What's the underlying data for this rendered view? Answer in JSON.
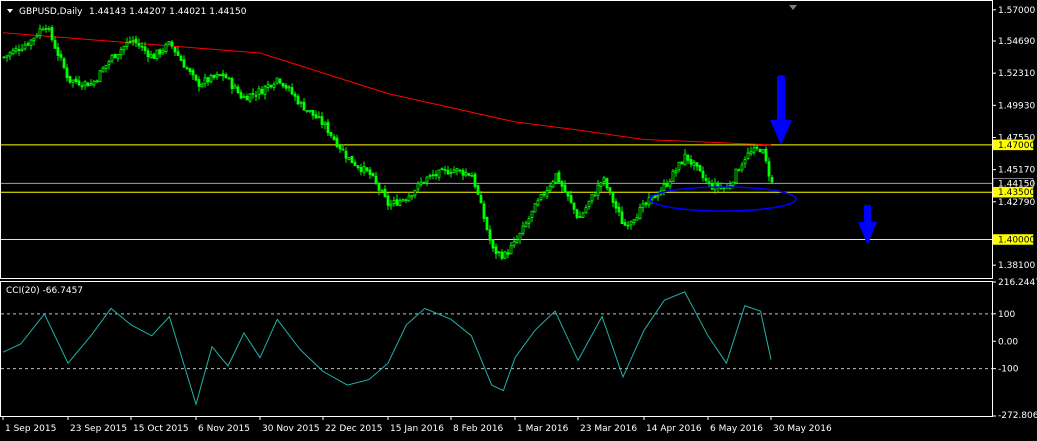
{
  "header": {
    "symbol_label": "GBPUSD,Daily",
    "ohlc_label": "1.44143 1.44207 1.44021 1.44150"
  },
  "colors": {
    "background": "#000000",
    "frame": "#ffffff",
    "bull": "#00ff00",
    "ma": "#ff0000",
    "hline": "#ffff00",
    "bid": "#a0a0a0",
    "cci": "#20b2aa",
    "annot": "#0000ff"
  },
  "chart_data": [
    {
      "type": "candlestick",
      "title": "GBPUSD,Daily",
      "ylim": [
        1.3715,
        1.5765
      ],
      "yticks": [
        "1.57000",
        "1.54690",
        "1.52310",
        "1.49930",
        "1.47550",
        "1.45170",
        "1.42790",
        "1.38100"
      ],
      "price_labels": [
        {
          "text": "1.47000",
          "value": 1.47,
          "style": "yellow"
        },
        {
          "text": "1.44150",
          "value": 1.4415,
          "style": "grey"
        },
        {
          "text": "1.43500",
          "value": 1.435,
          "style": "yellow"
        },
        {
          "text": "1.40000",
          "value": 1.4,
          "style": "yellow"
        }
      ],
      "horizontal_lines": [
        1.47,
        1.435,
        1.4
      ],
      "bid_line": 1.4415,
      "x": [
        "1 Sep 2015",
        "23 Sep 2015",
        "15 Oct 2015",
        "6 Nov 2015",
        "30 Nov 2015",
        "22 Dec 2015",
        "15 Jan 2016",
        "8 Feb 2016",
        "1 Mar 2016",
        "23 Mar 2016",
        "14 Apr 2016",
        "6 May 2016",
        "30 May 2016"
      ],
      "close_path": [
        [
          "1 Sep 2015",
          1.535
        ],
        [
          "10 Sep 2015",
          1.547
        ],
        [
          "15 Sep 2015",
          1.56
        ],
        [
          "23 Sep 2015",
          1.518
        ],
        [
          "1 Oct 2015",
          1.515
        ],
        [
          "8 Oct 2015",
          1.535
        ],
        [
          "15 Oct 2015",
          1.548
        ],
        [
          "22 Oct 2015",
          1.535
        ],
        [
          "28 Oct 2015",
          1.545
        ],
        [
          "6 Nov 2015",
          1.515
        ],
        [
          "16 Nov 2015",
          1.522
        ],
        [
          "23 Nov 2015",
          1.505
        ],
        [
          "30 Nov 2015",
          1.51
        ],
        [
          "6 Dec 2015",
          1.52
        ],
        [
          "14 Dec 2015",
          1.5
        ],
        [
          "22 Dec 2015",
          1.485
        ],
        [
          "31 Dec 2015",
          1.46
        ],
        [
          "8 Jan 2016",
          1.448
        ],
        [
          "15 Jan 2016",
          1.425
        ],
        [
          "22 Jan 2016",
          1.432
        ],
        [
          "29 Jan 2016",
          1.445
        ],
        [
          "8 Feb 2016",
          1.452
        ],
        [
          "15 Feb 2016",
          1.448
        ],
        [
          "22 Feb 2016",
          1.392
        ],
        [
          "26 Feb 2016",
          1.388
        ],
        [
          "1 Mar 2016",
          1.398
        ],
        [
          "8 Mar 2016",
          1.425
        ],
        [
          "15 Mar 2016",
          1.448
        ],
        [
          "23 Mar 2016",
          1.415
        ],
        [
          "31 Mar 2016",
          1.445
        ],
        [
          "7 Apr 2016",
          1.41
        ],
        [
          "14 Apr 2016",
          1.425
        ],
        [
          "21 Apr 2016",
          1.44
        ],
        [
          "28 Apr 2016",
          1.462
        ],
        [
          "6 May 2016",
          1.44
        ],
        [
          "13 May 2016",
          1.438
        ],
        [
          "20 May 2016",
          1.462
        ],
        [
          "26 May 2016",
          1.468
        ],
        [
          "30 May 2016",
          1.4415
        ]
      ],
      "moving_average": [
        [
          "1 Sep 2015",
          1.553
        ],
        [
          "30 Nov 2015",
          1.538
        ],
        [
          "15 Jan 2016",
          1.508
        ],
        [
          "1 Mar 2016",
          1.487
        ],
        [
          "23 Mar 2016",
          1.481
        ],
        [
          "14 Apr 2016",
          1.474
        ],
        [
          "30 May 2016",
          1.47
        ]
      ]
    },
    {
      "type": "line",
      "title": "CCI(20) -66.7457",
      "ylim": [
        -272.8061,
        216.2447
      ],
      "yticks": [
        "216.2447",
        "100",
        "0.00",
        "-100",
        "-272.8061"
      ],
      "levels": [
        100,
        -100
      ],
      "series": [
        {
          "name": "CCI(20)",
          "values": [
            [
              "1 Sep 2015",
              -40
            ],
            [
              "7 Sep 2015",
              -10
            ],
            [
              "15 Sep 2015",
              100
            ],
            [
              "23 Sep 2015",
              -80
            ],
            [
              "1 Oct 2015",
              20
            ],
            [
              "8 Oct 2015",
              120
            ],
            [
              "15 Oct 2015",
              60
            ],
            [
              "22 Oct 2015",
              20
            ],
            [
              "28 Oct 2015",
              90
            ],
            [
              "6 Nov 2015",
              -230
            ],
            [
              "12 Nov 2015",
              -20
            ],
            [
              "18 Nov 2015",
              -90
            ],
            [
              "24 Nov 2015",
              30
            ],
            [
              "30 Nov 2015",
              -60
            ],
            [
              "6 Dec 2015",
              80
            ],
            [
              "14 Dec 2015",
              -30
            ],
            [
              "22 Dec 2015",
              -110
            ],
            [
              "31 Dec 2015",
              -160
            ],
            [
              "8 Jan 2016",
              -140
            ],
            [
              "15 Jan 2016",
              -80
            ],
            [
              "22 Jan 2016",
              60
            ],
            [
              "29 Jan 2016",
              120
            ],
            [
              "8 Feb 2016",
              80
            ],
            [
              "15 Feb 2016",
              20
            ],
            [
              "22 Feb 2016",
              -160
            ],
            [
              "26 Feb 2016",
              -180
            ],
            [
              "1 Mar 2016",
              -60
            ],
            [
              "8 Mar 2016",
              40
            ],
            [
              "15 Mar 2016",
              110
            ],
            [
              "23 Mar 2016",
              -70
            ],
            [
              "31 Mar 2016",
              90
            ],
            [
              "7 Apr 2016",
              -130
            ],
            [
              "14 Apr 2016",
              40
            ],
            [
              "21 Apr 2016",
              150
            ],
            [
              "28 Apr 2016",
              180
            ],
            [
              "6 May 2016",
              20
            ],
            [
              "13 May 2016",
              -80
            ],
            [
              "20 May 2016",
              130
            ],
            [
              "26 May 2016",
              110
            ],
            [
              "30 May 2016",
              -66.7457
            ]
          ]
        }
      ]
    }
  ]
}
